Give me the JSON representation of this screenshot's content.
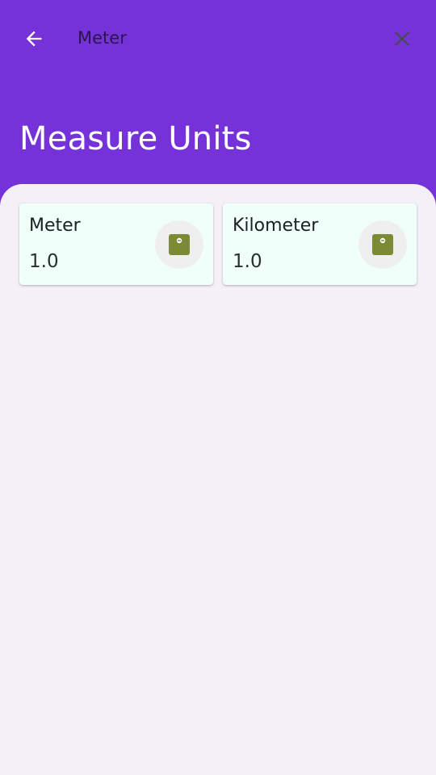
{
  "toolbar": {
    "back_icon": "arrow-back-icon",
    "title": "Meter",
    "close_icon": "close-icon"
  },
  "header": {
    "title": "Measure Units"
  },
  "units": [
    {
      "name": "Meter",
      "value": "1.0",
      "icon": "scale-icon"
    },
    {
      "name": "Kilometer",
      "value": "1.0",
      "icon": "scale-icon"
    }
  ],
  "colors": {
    "header_bg": "#7632d9",
    "content_bg": "#f5f0f7",
    "card_bg": "#f0fff9",
    "icon_accent": "#7b8b35"
  }
}
